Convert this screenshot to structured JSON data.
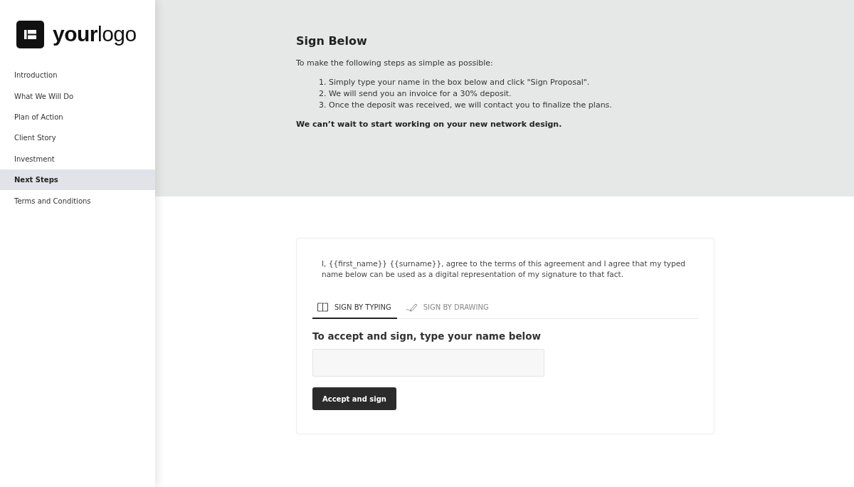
{
  "logo": {
    "text": "**your**logo"
  },
  "sidebar": {
    "items": [
      {
        "label": "Introduction",
        "selected": false
      },
      {
        "label": "What We Will Do",
        "selected": false
      },
      {
        "label": "Plan of Action",
        "selected": false
      },
      {
        "label": "Client Story",
        "selected": false
      },
      {
        "label": "Investment",
        "selected": false
      },
      {
        "label": "Next Steps",
        "selected": true
      },
      {
        "label": "Terms and Conditions",
        "selected": false
      }
    ]
  },
  "header": {
    "title": "Sign Below",
    "intro": "To make the following steps as simple as possible:",
    "steps": [
      "1. Simply type your name in the box below and click \"Sign Proposal\".",
      "2. We will send you an invoice for a 30% deposit.",
      "3. Once the deposit was received, we will contact you to finalize the plans."
    ],
    "closing": "We can’t wait to start working on your new network design."
  },
  "signature": {
    "agreement": "I, {{first_name}} {{surname}}, agree to the terms of this agreement and I agree that my typed name below can be used as a digital representation of my signature to that fact.",
    "tabs": [
      {
        "label": "SIGN BY TYPING",
        "kind": "typing",
        "selected": true
      },
      {
        "label": "SIGN BY DRAWING",
        "kind": "drawing",
        "selected": false
      }
    ],
    "prompt": "To accept and sign, type your name below",
    "button": "Accept and sign"
  }
}
